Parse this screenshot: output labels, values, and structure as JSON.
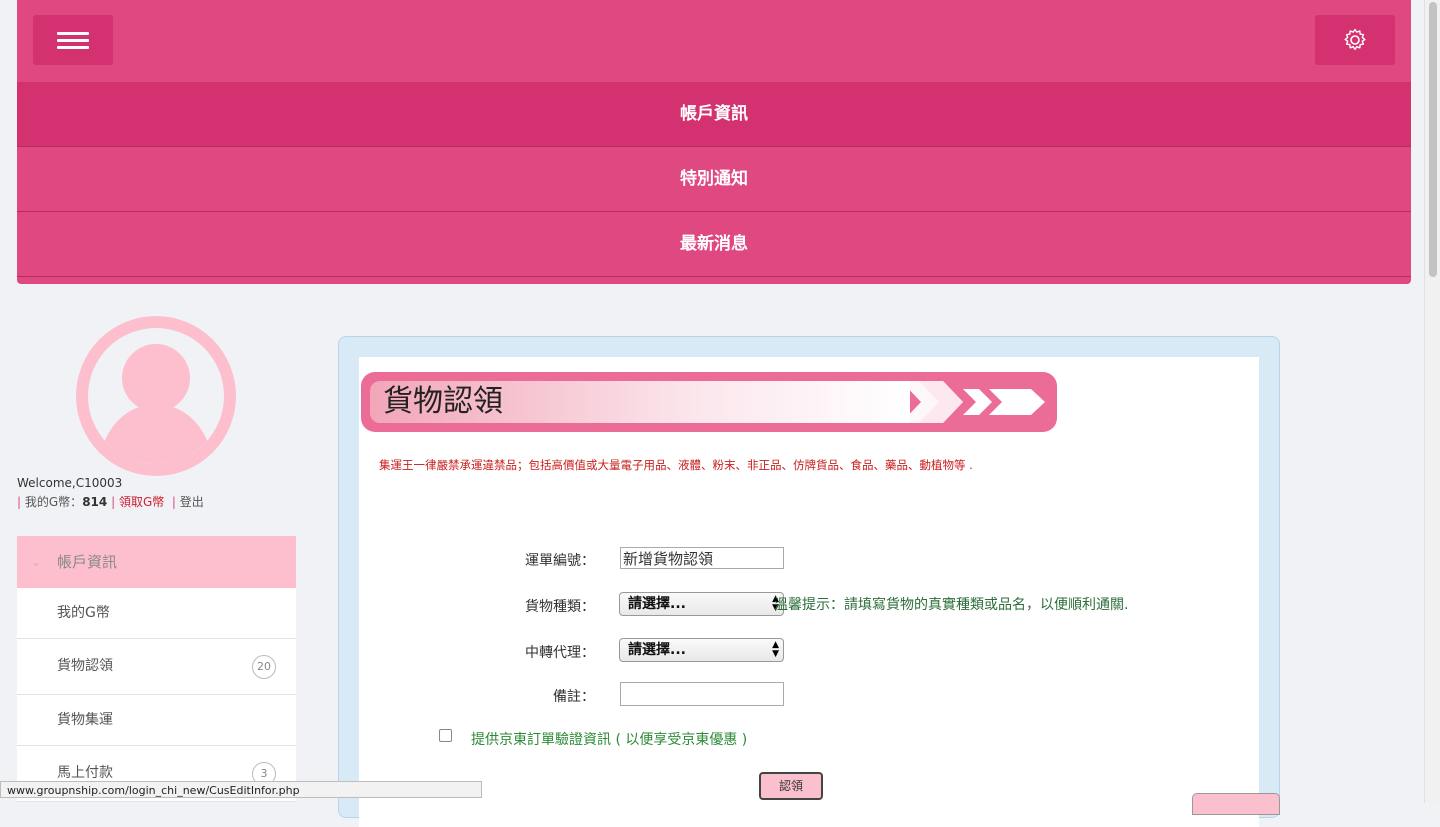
{
  "header": {
    "nav": [
      "帳戶資訊",
      "特別通知",
      "最新消息"
    ]
  },
  "profile": {
    "welcome": "Welcome,C10003",
    "sep": "|",
    "g_coins_label": "我的G幣：",
    "g_coins_value": "814",
    "claim_link": "領取G幣",
    "logout": "登出"
  },
  "sidebar": {
    "header": "帳戶資訊",
    "items": [
      {
        "label": "我的G幣",
        "badge": ""
      },
      {
        "label": "貨物認領",
        "badge": "20"
      },
      {
        "label": "貨物集運",
        "badge": ""
      },
      {
        "label": "馬上付款",
        "badge": "3"
      }
    ]
  },
  "main": {
    "banner_title": "貨物認領",
    "notice": "集運王一律嚴禁承運違禁品；包括高價值或大量電子用品、液體、粉末、非正品、仿牌貨品、食品、藥品、動植物等 .",
    "form": {
      "waybill_label": "運單編號：",
      "waybill_value": "新增貨物認領",
      "category_label": "貨物種類：",
      "category_value": "請選擇...",
      "category_hint": "溫馨提示：請填寫貨物的真實種類或品名，以便順利通關.",
      "agent_label": "中轉代理：",
      "agent_value": "請選擇...",
      "note_label": "備註：",
      "note_value": "",
      "jd_checkbox_label": "提供京東訂單驗證資訊 ( 以便享受京東優惠 )",
      "submit_label": "認領"
    }
  },
  "statusbar": {
    "url": "www.groupnship.com/login_chi_new/CusEditInfor.php"
  },
  "colors": {
    "header": "#e04882",
    "header_dark": "#d3316f",
    "sidebar_active": "#fdbfce",
    "banner": "#ec6c98",
    "notice": "#c8201f",
    "hint": "#2c6e3a"
  },
  "icons": [
    "hamburger-icon",
    "gear-icon",
    "user-avatar-icon",
    "chevron-arrows-icon",
    "chevron-down-icon"
  ]
}
